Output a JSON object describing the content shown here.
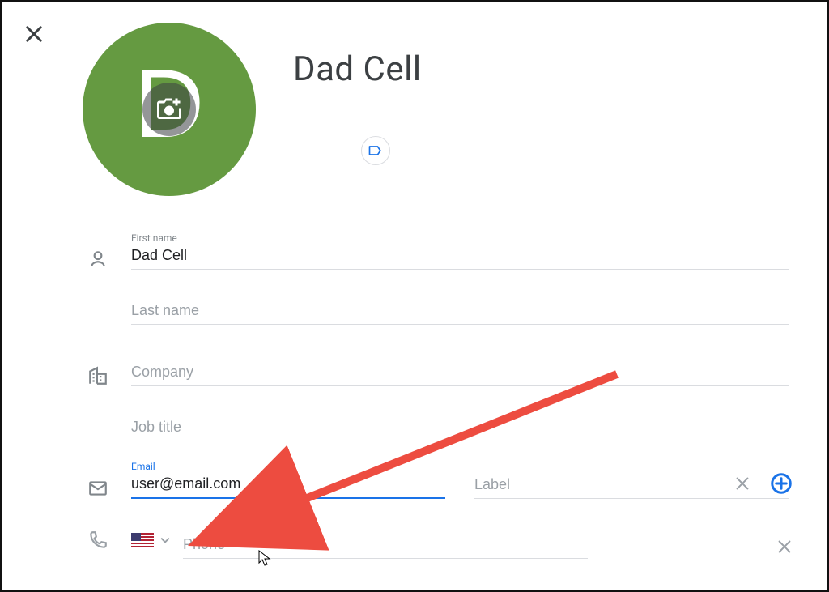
{
  "contact": {
    "display_name": "Dad Cell",
    "avatar_letter": "D"
  },
  "fields": {
    "first_name": {
      "label": "First name",
      "value": "Dad Cell"
    },
    "last_name": {
      "placeholder": "Last name",
      "value": ""
    },
    "company": {
      "placeholder": "Company",
      "value": ""
    },
    "job_title": {
      "placeholder": "Job title",
      "value": ""
    },
    "email": {
      "label": "Email",
      "value": "user@email.com"
    },
    "email_label": {
      "placeholder": "Label",
      "value": ""
    },
    "phone": {
      "placeholder": "Phone",
      "value": ""
    }
  }
}
